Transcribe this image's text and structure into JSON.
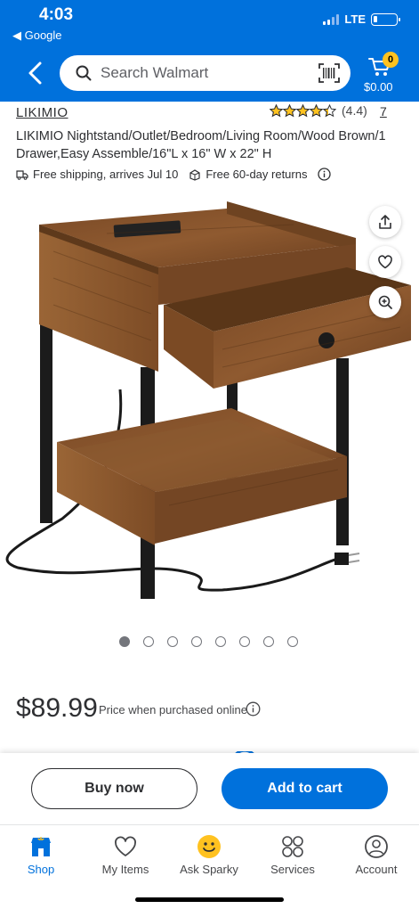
{
  "status_bar": {
    "time": "4:03",
    "back_app": "◀ Google",
    "network": "LTE"
  },
  "header": {
    "search_placeholder": "Search Walmart",
    "cart_count": "0",
    "cart_total": "$0.00",
    "brand_color": "#0071dc",
    "badge_color": "#ffc220"
  },
  "product": {
    "brand": "LIKIMIO",
    "rating": 4.4,
    "rating_text": "(4.4)",
    "review_count": "7",
    "title": "LIKIMIO Nightstand/Outlet/Bedroom/Living Room/Wood Brown/1 Drawer,Easy Assemble/16\"L x 16\" W x 22\" H",
    "shipping": "Free shipping, arrives Jul 10",
    "returns": "Free 60-day returns",
    "image_count": 8,
    "active_image": 1
  },
  "price": {
    "amount": "$89.99",
    "note": "Price when purchased online"
  },
  "actions": {
    "buy_now": "Buy now",
    "add_to_cart": "Add to cart"
  },
  "nav": {
    "items": [
      {
        "label": "Shop",
        "icon": "store-icon"
      },
      {
        "label": "My Items",
        "icon": "heart-icon"
      },
      {
        "label": "Ask Sparky",
        "icon": "sparky-icon"
      },
      {
        "label": "Services",
        "icon": "services-icon"
      },
      {
        "label": "Account",
        "icon": "account-icon"
      }
    ]
  }
}
